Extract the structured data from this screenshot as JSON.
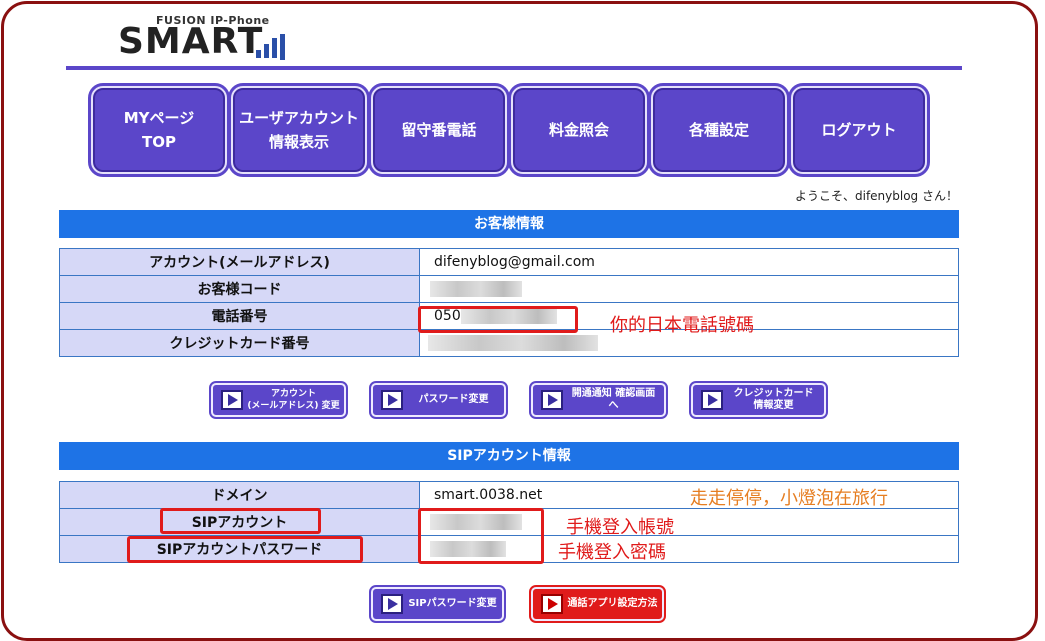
{
  "logo": {
    "sub": "FUSION IP-Phone",
    "main": "SMART"
  },
  "nav": [
    {
      "label": "MYページ\nTOP"
    },
    {
      "label": "ユーザアカウント\n情報表示"
    },
    {
      "label": "留守番電話"
    },
    {
      "label": "料金照会"
    },
    {
      "label": "各種設定"
    },
    {
      "label": "ログアウト"
    }
  ],
  "welcome": "ようこそ、difenyblog さん！",
  "customer": {
    "title": "お客様情報",
    "rows": [
      {
        "label": "アカウント(メールアドレス)",
        "value": "difenyblog@gmail.com"
      },
      {
        "label": "お客様コード",
        "value": ""
      },
      {
        "label": "電話番号",
        "value": "050"
      },
      {
        "label": "クレジットカード番号",
        "value": ""
      }
    ],
    "buttons": [
      {
        "label": "アカウント\n(メールアドレス) 変更"
      },
      {
        "label": "パスワード変更"
      },
      {
        "label": "開通通知 確認画面へ"
      },
      {
        "label": "クレジットカード\n情報変更"
      }
    ]
  },
  "sip": {
    "title": "SIPアカウント情報",
    "rows": [
      {
        "label": "ドメイン",
        "value": "smart.0038.net"
      },
      {
        "label": "SIPアカウント",
        "value": ""
      },
      {
        "label": "SIPアカウントパスワード",
        "value": ""
      }
    ],
    "buttons": [
      {
        "label": "SIPパスワード変更"
      },
      {
        "label": "通話アプリ設定方法"
      }
    ]
  },
  "annotations": {
    "phone": "你的日本電話號碼",
    "blog": "走走停停，小燈泡在旅行",
    "account": "手機登入帳號",
    "password": "手機登入密碼"
  },
  "colors": {
    "accent": "#5b46c9",
    "section": "#1e73e6",
    "label_bg": "#d6d8f7",
    "annotation_red": "#e01b1b",
    "annotation_orange": "#e67e22"
  }
}
